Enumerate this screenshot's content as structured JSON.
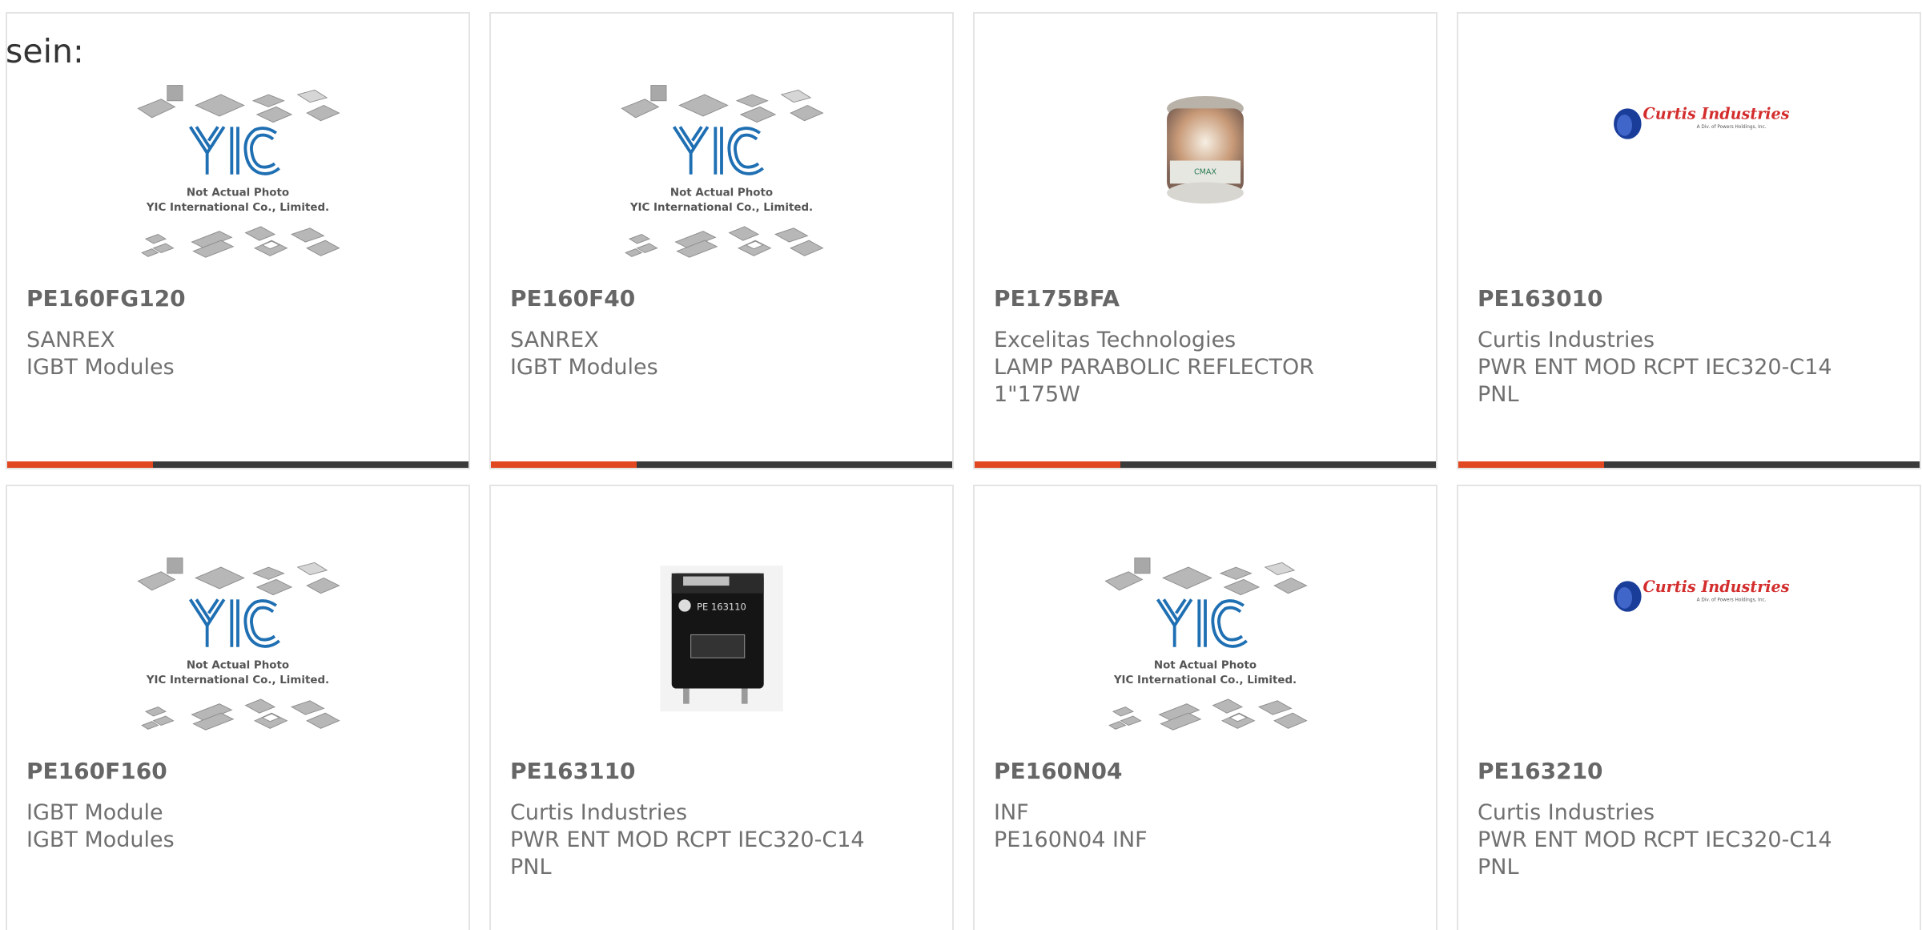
{
  "intro_text": "sein:",
  "placeholder_caption": {
    "line1": "Not Actual Photo",
    "line2": "YIC International Co., Limited."
  },
  "brand_logo": {
    "name": "Curtis Industries",
    "tagline": "A Div. of Powers Holdings, Inc."
  },
  "colors": {
    "accent": "#e14822",
    "bar_dark": "#3a3a3a",
    "yic_blue": "#1f6fb3",
    "text": "#707070",
    "part_text": "#666666"
  },
  "products": [
    {
      "part": "PE160FG120",
      "manufacturer": "SANREX",
      "description_lines": [
        "IGBT Modules"
      ],
      "image": "yic-placeholder"
    },
    {
      "part": "PE160F40",
      "manufacturer": "SANREX",
      "description_lines": [
        "IGBT Modules"
      ],
      "image": "yic-placeholder"
    },
    {
      "part": "PE175BFA",
      "manufacturer": "Excelitas Technologies",
      "description_lines": [
        "LAMP PARABOLIC REFLECTOR",
        "1\"175W"
      ],
      "image": "lamp-photo"
    },
    {
      "part": "PE163010",
      "manufacturer": "Curtis Industries",
      "description_lines": [
        "PWR ENT MOD RCPT IEC320-C14",
        "PNL"
      ],
      "image": "curtis-logo"
    },
    {
      "part": "PE160F160",
      "manufacturer": "IGBT Module",
      "description_lines": [
        "IGBT Modules"
      ],
      "image": "yic-placeholder"
    },
    {
      "part": "PE163110",
      "manufacturer": "Curtis Industries",
      "description_lines": [
        "PWR ENT MOD RCPT IEC320-C14",
        "PNL"
      ],
      "image": "power-module-photo",
      "image_label": "PE 163110"
    },
    {
      "part": "PE160N04",
      "manufacturer": "INF",
      "description_lines": [
        "PE160N04 INF"
      ],
      "image": "yic-placeholder"
    },
    {
      "part": "PE163210",
      "manufacturer": "Curtis Industries",
      "description_lines": [
        "PWR ENT MOD RCPT IEC320-C14",
        "PNL"
      ],
      "image": "curtis-logo"
    }
  ]
}
